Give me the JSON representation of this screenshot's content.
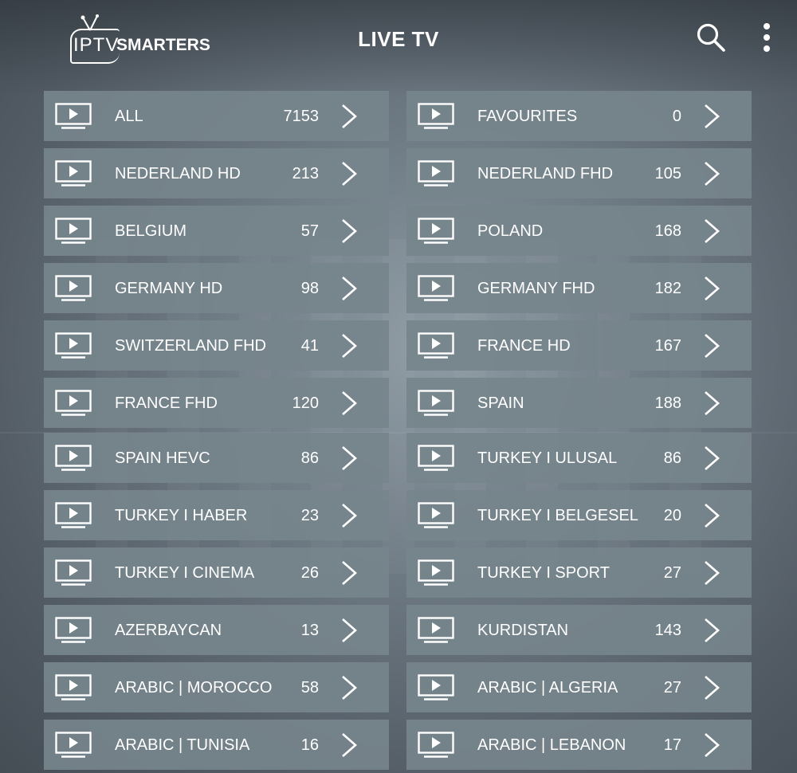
{
  "header": {
    "logo_iptv": "IPTV",
    "logo_smarters": "SMARTERS",
    "title": "LIVE TV"
  },
  "colors": {
    "tile": "#76848c",
    "text": "#ffffff"
  },
  "icons": {
    "search": "search-icon",
    "more": "more-vertical-icon",
    "category": "tv-play-icon",
    "arrow": "chevron-right-icon"
  },
  "categories": [
    {
      "name": "ALL",
      "count": "7153"
    },
    {
      "name": "FAVOURITES",
      "count": "0"
    },
    {
      "name": "NEDERLAND HD",
      "count": "213"
    },
    {
      "name": "NEDERLAND FHD",
      "count": "105"
    },
    {
      "name": "BELGIUM",
      "count": "57"
    },
    {
      "name": "POLAND",
      "count": "168"
    },
    {
      "name": "GERMANY HD",
      "count": "98"
    },
    {
      "name": "GERMANY FHD",
      "count": "182"
    },
    {
      "name": "SWITZERLAND FHD",
      "count": "41"
    },
    {
      "name": "FRANCE HD",
      "count": "167"
    },
    {
      "name": "FRANCE FHD",
      "count": "120"
    },
    {
      "name": "SPAIN",
      "count": "188"
    },
    {
      "name": "SPAIN HEVC",
      "count": "86"
    },
    {
      "name": "TURKEY I ULUSAL",
      "count": "86"
    },
    {
      "name": "TURKEY I HABER",
      "count": "23"
    },
    {
      "name": "TURKEY I BELGESEL",
      "count": "20"
    },
    {
      "name": "TURKEY I CINEMA",
      "count": "26"
    },
    {
      "name": "TURKEY I SPORT",
      "count": "27"
    },
    {
      "name": "AZERBAYCAN",
      "count": "13"
    },
    {
      "name": "KURDISTAN",
      "count": "143"
    },
    {
      "name": "ARABIC | MOROCCO",
      "count": "58"
    },
    {
      "name": "ARABIC | ALGERIA",
      "count": "27"
    },
    {
      "name": "ARABIC | TUNISIA",
      "count": "16"
    },
    {
      "name": "ARABIC | LEBANON",
      "count": "17"
    }
  ]
}
